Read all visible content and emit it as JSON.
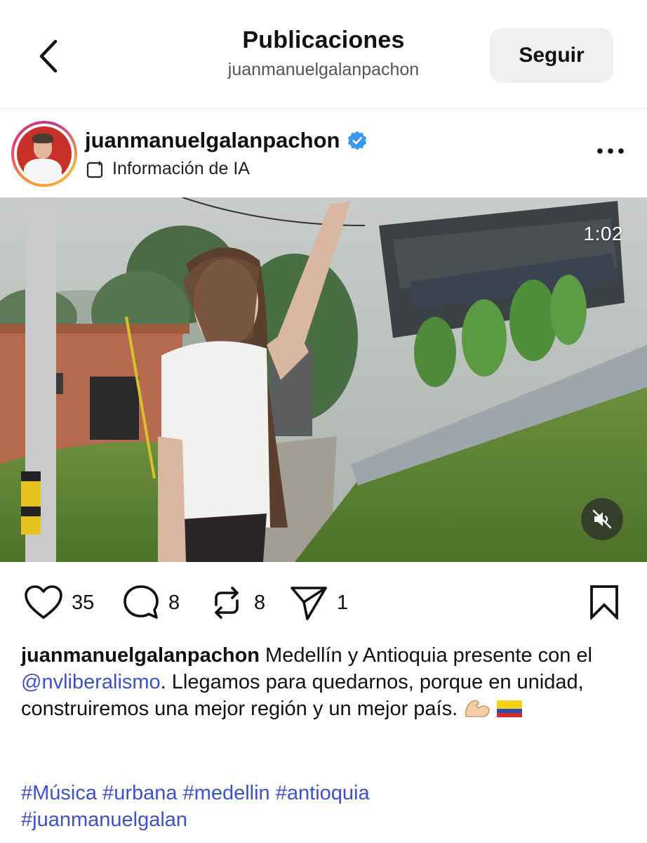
{
  "header": {
    "title": "Publicaciones",
    "subtitle": "juanmanuelgalanpachon",
    "follow_label": "Seguir",
    "back_icon": "chevron-left-icon"
  },
  "post": {
    "username": "juanmanuelgalanpachon",
    "verified_icon": "verified-badge-icon",
    "ai_info": "Información de IA",
    "more_icon": "more-horizontal-icon",
    "video": {
      "duration": "1:02",
      "mute_icon": "speaker-muted-icon"
    },
    "actions": {
      "likes": "35",
      "comments": "8",
      "reposts": "8",
      "shares": "1",
      "like_icon": "heart-icon",
      "comment_icon": "comment-bubble-icon",
      "repost_icon": "repost-icon",
      "share_icon": "send-icon",
      "save_icon": "bookmark-icon"
    },
    "caption": {
      "author": "juanmanuelgalanpachon",
      "text_1": " Medellín y Antioquia presente con el ",
      "mention": "@nvliberalismo",
      "text_2": ". Llegamos para quedarnos, porque en unidad, construiremos una mejor región y un mejor país. ",
      "emojis": [
        "flexed-biceps",
        "colombia-flag"
      ]
    },
    "hashtags": [
      "#Música",
      "#urbana",
      "#medellin",
      "#antioquia",
      "#juanmanuelgalan"
    ]
  },
  "colors": {
    "accent_link": "#3d52c8",
    "verified_blue": "#3897f0",
    "follow_bg": "#eff0f2"
  }
}
